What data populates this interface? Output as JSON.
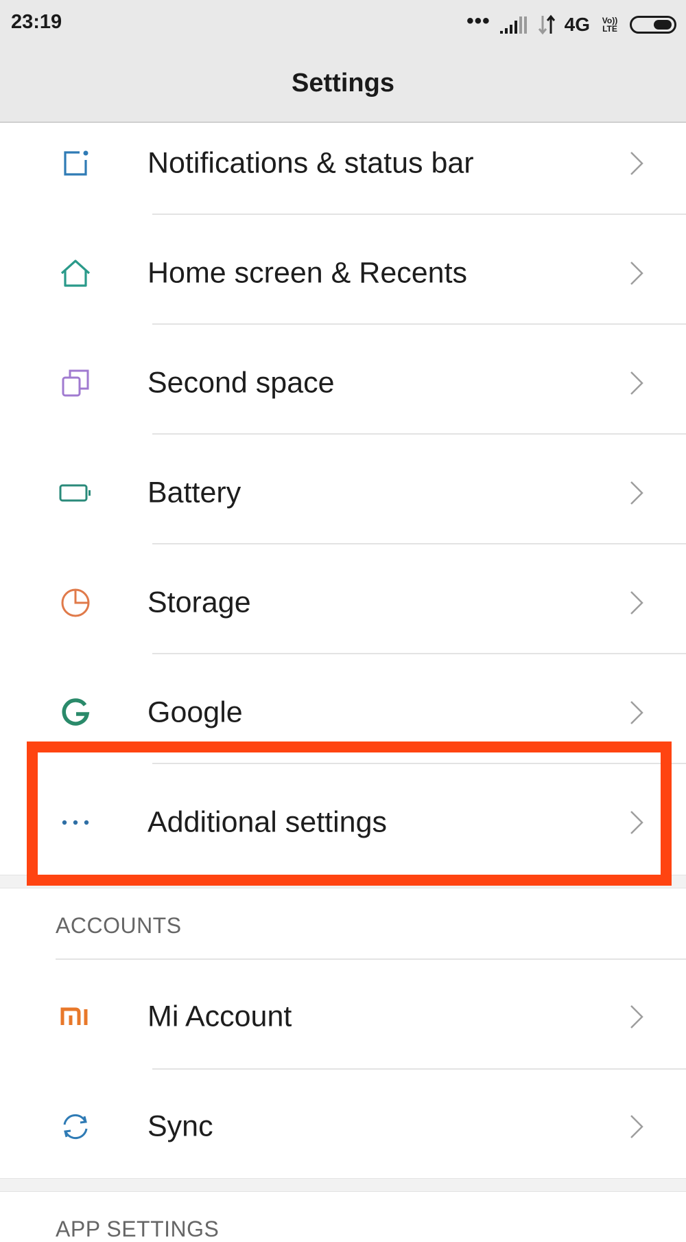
{
  "status_bar": {
    "time": "23:19",
    "dots": "•••",
    "network_type": "4G",
    "volte": "Vo))\nLTE"
  },
  "header": {
    "title": "Settings"
  },
  "settings_items": [
    {
      "label": "Notifications & status bar",
      "icon": "notification-icon",
      "color": "#2f7bb5"
    },
    {
      "label": "Home screen & Recents",
      "icon": "home-icon",
      "color": "#2a9a8a"
    },
    {
      "label": "Second space",
      "icon": "second-space-icon",
      "color": "#a07ad0"
    },
    {
      "label": "Battery",
      "icon": "battery-icon",
      "color": "#2a8a7a"
    },
    {
      "label": "Storage",
      "icon": "storage-icon",
      "color": "#e07a4a"
    },
    {
      "label": "Google",
      "icon": "google-icon",
      "color": "#2a8a6a"
    },
    {
      "label": "Additional settings",
      "icon": "more-icon",
      "color": "#2f6fa5"
    }
  ],
  "accounts_section": {
    "header": "ACCOUNTS",
    "items": [
      {
        "label": "Mi Account",
        "icon": "mi-icon",
        "color": "#e8782a"
      },
      {
        "label": "Sync",
        "icon": "sync-icon",
        "color": "#2f7bb5"
      }
    ]
  },
  "app_settings_section": {
    "header": "APP SETTINGS"
  },
  "highlight": {
    "target": "Additional settings",
    "color": "#ff4411"
  }
}
